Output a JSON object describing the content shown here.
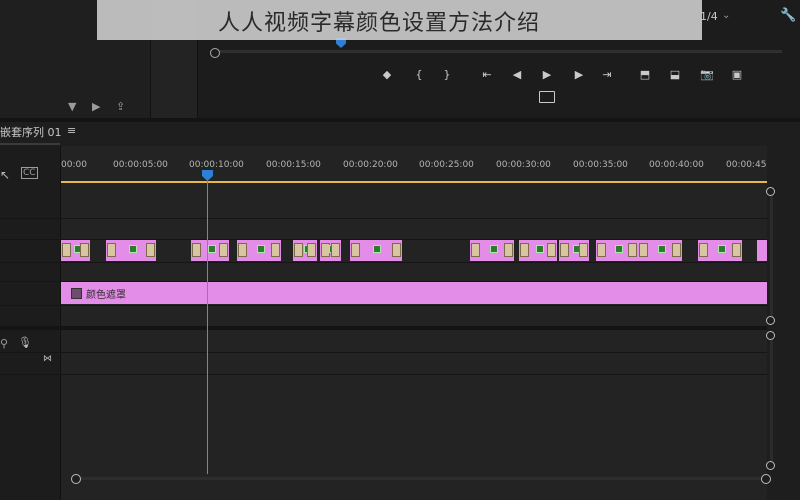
{
  "watermark": {
    "text": "人人视频字幕颜色设置方法介绍"
  },
  "monitor": {
    "fraction": "1/4",
    "zoom_chevron": "⌄",
    "wrench_icon": "🔧",
    "transport": [
      {
        "name": "add-marker-button",
        "glyph": "◆"
      },
      {
        "name": "mark-in-button",
        "glyph": "{"
      },
      {
        "name": "mark-out-button",
        "glyph": "}"
      },
      {
        "name": "go-to-in-button",
        "glyph": "⇤"
      },
      {
        "name": "step-back-button",
        "glyph": "◀"
      },
      {
        "name": "play-button",
        "glyph": "▶"
      },
      {
        "name": "step-forward-button",
        "glyph": "▶"
      },
      {
        "name": "go-to-out-button",
        "glyph": "⇥"
      },
      {
        "name": "lift-button",
        "glyph": "⬒"
      },
      {
        "name": "extract-button",
        "glyph": "⬓"
      },
      {
        "name": "export-frame-button",
        "glyph": "📷"
      },
      {
        "name": "compare-button",
        "glyph": "▣"
      }
    ]
  },
  "tools": {
    "filter_icon": "▼",
    "tool2": "▶",
    "tool3": "⇪"
  },
  "sequence": {
    "name": "嵌套序列 01",
    "menu_icon": "≡"
  },
  "ruler": {
    "ticks": [
      "00:00",
      "00:00:05:00",
      "00:00:10:00",
      "00:00:15:00",
      "00:00:20:00",
      "00:00:25:00",
      "00:00:30:00",
      "00:00:35:00",
      "00:00:40:00",
      "00:00:45:"
    ]
  },
  "matte": {
    "label": "颜色遮罩"
  },
  "track_icons": {
    "snap": "↖",
    "cc": "CC",
    "mic": "🎙",
    "link": "⚲",
    "bowtie": "⋈"
  },
  "colors": {
    "clip": "#e48de8",
    "playhead": "#2e7fd8",
    "workarea": "#e2b94a"
  }
}
